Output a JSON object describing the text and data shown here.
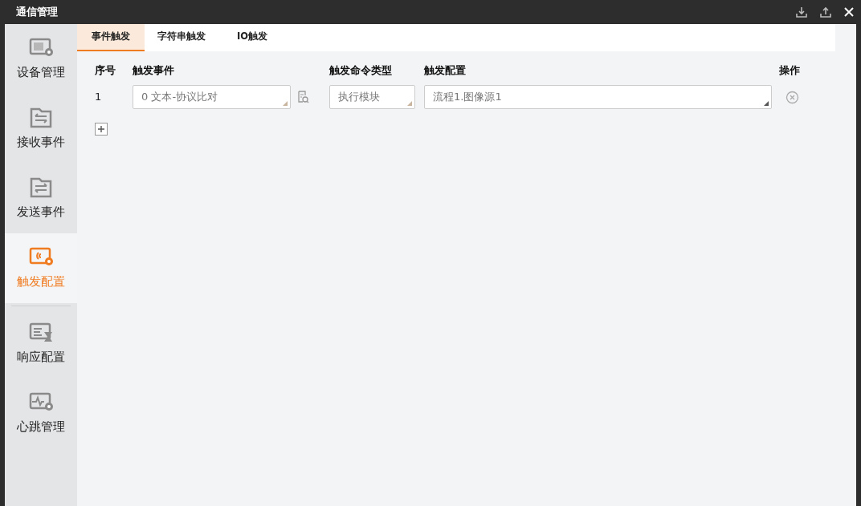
{
  "window": {
    "title": "通信管理"
  },
  "sidebar": {
    "items": [
      {
        "label": "设备管理",
        "selected": false
      },
      {
        "label": "接收事件",
        "selected": false
      },
      {
        "label": "发送事件",
        "selected": false
      },
      {
        "label": "触发配置",
        "selected": true
      },
      {
        "label": "响应配置",
        "selected": false
      },
      {
        "label": "心跳管理",
        "selected": false
      }
    ]
  },
  "tabs": [
    {
      "label": "事件触发",
      "selected": true
    },
    {
      "label": "字符串触发",
      "selected": false
    },
    {
      "label": "IO触发",
      "selected": false
    }
  ],
  "table": {
    "columns": [
      "序号",
      "触发事件",
      "触发命令类型",
      "触发配置",
      "操作"
    ],
    "rows": [
      {
        "index": "1",
        "event": "0 文本-协议比对",
        "command_type": "执行模块",
        "config": "流程1.图像源1"
      }
    ]
  }
}
